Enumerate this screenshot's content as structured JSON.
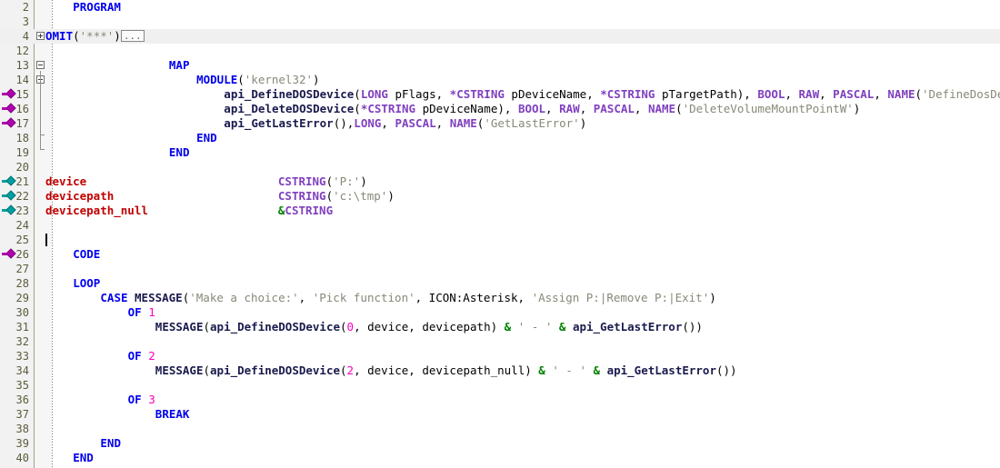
{
  "editor": {
    "language": "Clarion",
    "line_height": 16,
    "first_visible_line": 2,
    "colors": {
      "background": "#ffffff",
      "gutter": "#f2f2f2",
      "line_number": "#5c5c3d",
      "keyword": "#0000ee",
      "type": "#8040c0",
      "function": "#1a1a4d",
      "variable": "#c00000",
      "string": "#888878",
      "number": "#ff00c0",
      "operator": "#008000",
      "highlight_row": "#f0f0f0",
      "marker_bookmark": "#b300b3",
      "marker_breakpoint": "#00a0a0"
    },
    "caret": {
      "line": 25,
      "column": 1
    }
  },
  "lines": [
    {
      "num": "2",
      "indent": 4,
      "highlight": false,
      "marker": "",
      "fold": "",
      "tokens": [
        {
          "t": "PROGRAM",
          "c": "kw"
        }
      ]
    },
    {
      "num": "3",
      "indent": 0,
      "highlight": false,
      "marker": "",
      "fold": "",
      "tokens": []
    },
    {
      "num": "4",
      "indent": 0,
      "highlight": true,
      "marker": "",
      "fold": "plus",
      "tokens": [
        {
          "t": "OMIT",
          "c": "kw"
        },
        {
          "t": "(",
          "c": "pl"
        },
        {
          "t": "'***'",
          "c": "str"
        },
        {
          "t": ")",
          "c": "pl"
        },
        {
          "t": "...",
          "c": "collapsed"
        }
      ]
    },
    {
      "num": "12",
      "indent": 0,
      "highlight": false,
      "marker": "",
      "fold": "",
      "tokens": []
    },
    {
      "num": "13",
      "indent": 18,
      "highlight": false,
      "marker": "",
      "fold": "minus",
      "tokens": [
        {
          "t": "MAP",
          "c": "kw"
        }
      ]
    },
    {
      "num": "14",
      "indent": 22,
      "highlight": false,
      "marker": "",
      "fold": "minus",
      "tokens": [
        {
          "t": "MODULE",
          "c": "kw"
        },
        {
          "t": "(",
          "c": "pl"
        },
        {
          "t": "'kernel32'",
          "c": "str"
        },
        {
          "t": ")",
          "c": "pl"
        }
      ]
    },
    {
      "num": "15",
      "indent": 26,
      "highlight": false,
      "marker": "magenta",
      "fold": "",
      "tokens": [
        {
          "t": "api_DefineDOSDevice",
          "c": "fn"
        },
        {
          "t": "(",
          "c": "pl"
        },
        {
          "t": "LONG",
          "c": "typ"
        },
        {
          "t": " pFlags, ",
          "c": "pl"
        },
        {
          "t": "*CSTRING",
          "c": "typ"
        },
        {
          "t": " pDeviceName, ",
          "c": "pl"
        },
        {
          "t": "*CSTRING",
          "c": "typ"
        },
        {
          "t": " pTargetPath), ",
          "c": "pl"
        },
        {
          "t": "BOOL",
          "c": "typ"
        },
        {
          "t": ", ",
          "c": "pl"
        },
        {
          "t": "RAW",
          "c": "typ"
        },
        {
          "t": ", ",
          "c": "pl"
        },
        {
          "t": "PASCAL",
          "c": "typ"
        },
        {
          "t": ", ",
          "c": "pl"
        },
        {
          "t": "NAME",
          "c": "typ"
        },
        {
          "t": "(",
          "c": "pl"
        },
        {
          "t": "'DefineDosDeviceA'",
          "c": "str"
        },
        {
          "t": ")",
          "c": "pl"
        }
      ]
    },
    {
      "num": "16",
      "indent": 26,
      "highlight": false,
      "marker": "magenta",
      "fold": "",
      "tokens": [
        {
          "t": "api_DeleteDOSDevice",
          "c": "fn"
        },
        {
          "t": "(",
          "c": "pl"
        },
        {
          "t": "*CSTRING",
          "c": "typ"
        },
        {
          "t": " pDeviceName), ",
          "c": "pl"
        },
        {
          "t": "BOOL",
          "c": "typ"
        },
        {
          "t": ", ",
          "c": "pl"
        },
        {
          "t": "RAW",
          "c": "typ"
        },
        {
          "t": ", ",
          "c": "pl"
        },
        {
          "t": "PASCAL",
          "c": "typ"
        },
        {
          "t": ", ",
          "c": "pl"
        },
        {
          "t": "NAME",
          "c": "typ"
        },
        {
          "t": "(",
          "c": "pl"
        },
        {
          "t": "'DeleteVolumeMountPointW'",
          "c": "str"
        },
        {
          "t": ")",
          "c": "pl"
        }
      ]
    },
    {
      "num": "17",
      "indent": 26,
      "highlight": false,
      "marker": "magenta",
      "fold": "",
      "tokens": [
        {
          "t": "api_GetLastError",
          "c": "fn"
        },
        {
          "t": "(),",
          "c": "pl"
        },
        {
          "t": "LONG",
          "c": "typ"
        },
        {
          "t": ", ",
          "c": "pl"
        },
        {
          "t": "PASCAL",
          "c": "typ"
        },
        {
          "t": ", ",
          "c": "pl"
        },
        {
          "t": "NAME",
          "c": "typ"
        },
        {
          "t": "(",
          "c": "pl"
        },
        {
          "t": "'GetLastError'",
          "c": "str"
        },
        {
          "t": ")",
          "c": "pl"
        }
      ]
    },
    {
      "num": "18",
      "indent": 22,
      "highlight": false,
      "marker": "",
      "fold": "",
      "tokens": [
        {
          "t": "END",
          "c": "kw"
        }
      ]
    },
    {
      "num": "19",
      "indent": 18,
      "highlight": false,
      "marker": "",
      "fold": "",
      "tokens": [
        {
          "t": "END",
          "c": "kw"
        }
      ]
    },
    {
      "num": "20",
      "indent": 0,
      "highlight": false,
      "marker": "",
      "fold": "",
      "tokens": []
    },
    {
      "num": "21",
      "indent": 0,
      "highlight": false,
      "marker": "teal",
      "fold": "",
      "tokens": [
        {
          "t": "device",
          "c": "var"
        },
        {
          "t": "                            ",
          "c": "pl"
        },
        {
          "t": "CSTRING",
          "c": "typ"
        },
        {
          "t": "(",
          "c": "pl"
        },
        {
          "t": "'P:'",
          "c": "str"
        },
        {
          "t": ")",
          "c": "pl"
        }
      ]
    },
    {
      "num": "22",
      "indent": 0,
      "highlight": false,
      "marker": "teal",
      "fold": "",
      "tokens": [
        {
          "t": "devicepath",
          "c": "var"
        },
        {
          "t": "                        ",
          "c": "pl"
        },
        {
          "t": "CSTRING",
          "c": "typ"
        },
        {
          "t": "(",
          "c": "pl"
        },
        {
          "t": "'c:\\tmp'",
          "c": "str"
        },
        {
          "t": ")",
          "c": "pl"
        }
      ]
    },
    {
      "num": "23",
      "indent": 0,
      "highlight": false,
      "marker": "teal",
      "fold": "",
      "tokens": [
        {
          "t": "devicepath_null",
          "c": "var"
        },
        {
          "t": "                   ",
          "c": "pl"
        },
        {
          "t": "&",
          "c": "amp"
        },
        {
          "t": "CSTRING",
          "c": "typ"
        }
      ]
    },
    {
      "num": "24",
      "indent": 0,
      "highlight": false,
      "marker": "",
      "fold": "",
      "tokens": []
    },
    {
      "num": "25",
      "indent": 0,
      "highlight": false,
      "marker": "",
      "fold": "",
      "tokens": []
    },
    {
      "num": "26",
      "indent": 4,
      "highlight": false,
      "marker": "magenta",
      "fold": "",
      "tokens": [
        {
          "t": "CODE",
          "c": "kw"
        }
      ]
    },
    {
      "num": "27",
      "indent": 0,
      "highlight": false,
      "marker": "",
      "fold": "",
      "tokens": []
    },
    {
      "num": "28",
      "indent": 4,
      "highlight": false,
      "marker": "",
      "fold": "",
      "tokens": [
        {
          "t": "LOOP",
          "c": "kw"
        }
      ]
    },
    {
      "num": "29",
      "indent": 8,
      "highlight": false,
      "marker": "",
      "fold": "",
      "tokens": [
        {
          "t": "CASE",
          "c": "kw"
        },
        {
          "t": " ",
          "c": "pl"
        },
        {
          "t": "MESSAGE",
          "c": "fn"
        },
        {
          "t": "(",
          "c": "pl"
        },
        {
          "t": "'Make a choice:'",
          "c": "str"
        },
        {
          "t": ", ",
          "c": "pl"
        },
        {
          "t": "'Pick function'",
          "c": "str"
        },
        {
          "t": ", ICON:Asterisk, ",
          "c": "pl"
        },
        {
          "t": "'Assign P:|Remove P:|Exit'",
          "c": "str"
        },
        {
          "t": ")",
          "c": "pl"
        }
      ]
    },
    {
      "num": "30",
      "indent": 12,
      "highlight": false,
      "marker": "",
      "fold": "",
      "tokens": [
        {
          "t": "OF",
          "c": "kw"
        },
        {
          "t": " ",
          "c": "pl"
        },
        {
          "t": "1",
          "c": "num"
        }
      ]
    },
    {
      "num": "31",
      "indent": 16,
      "highlight": false,
      "marker": "",
      "fold": "",
      "tokens": [
        {
          "t": "MESSAGE",
          "c": "fn"
        },
        {
          "t": "(",
          "c": "pl"
        },
        {
          "t": "api_DefineDOSDevice",
          "c": "fn"
        },
        {
          "t": "(",
          "c": "pl"
        },
        {
          "t": "0",
          "c": "num"
        },
        {
          "t": ", device, devicepath) ",
          "c": "pl"
        },
        {
          "t": "&",
          "c": "amp"
        },
        {
          "t": " ",
          "c": "pl"
        },
        {
          "t": "' - '",
          "c": "str"
        },
        {
          "t": " ",
          "c": "pl"
        },
        {
          "t": "&",
          "c": "amp"
        },
        {
          "t": " ",
          "c": "pl"
        },
        {
          "t": "api_GetLastError",
          "c": "fn"
        },
        {
          "t": "())",
          "c": "pl"
        }
      ]
    },
    {
      "num": "32",
      "indent": 0,
      "highlight": false,
      "marker": "",
      "fold": "",
      "tokens": []
    },
    {
      "num": "33",
      "indent": 12,
      "highlight": false,
      "marker": "",
      "fold": "",
      "tokens": [
        {
          "t": "OF",
          "c": "kw"
        },
        {
          "t": " ",
          "c": "pl"
        },
        {
          "t": "2",
          "c": "num"
        }
      ]
    },
    {
      "num": "34",
      "indent": 16,
      "highlight": false,
      "marker": "",
      "fold": "",
      "tokens": [
        {
          "t": "MESSAGE",
          "c": "fn"
        },
        {
          "t": "(",
          "c": "pl"
        },
        {
          "t": "api_DefineDOSDevice",
          "c": "fn"
        },
        {
          "t": "(",
          "c": "pl"
        },
        {
          "t": "2",
          "c": "num"
        },
        {
          "t": ", device, devicepath_null) ",
          "c": "pl"
        },
        {
          "t": "&",
          "c": "amp"
        },
        {
          "t": " ",
          "c": "pl"
        },
        {
          "t": "' - '",
          "c": "str"
        },
        {
          "t": " ",
          "c": "pl"
        },
        {
          "t": "&",
          "c": "amp"
        },
        {
          "t": " ",
          "c": "pl"
        },
        {
          "t": "api_GetLastError",
          "c": "fn"
        },
        {
          "t": "())",
          "c": "pl"
        }
      ]
    },
    {
      "num": "35",
      "indent": 0,
      "highlight": false,
      "marker": "",
      "fold": "",
      "tokens": []
    },
    {
      "num": "36",
      "indent": 12,
      "highlight": false,
      "marker": "",
      "fold": "",
      "tokens": [
        {
          "t": "OF",
          "c": "kw"
        },
        {
          "t": " ",
          "c": "pl"
        },
        {
          "t": "3",
          "c": "num"
        }
      ]
    },
    {
      "num": "37",
      "indent": 16,
      "highlight": false,
      "marker": "",
      "fold": "",
      "tokens": [
        {
          "t": "BREAK",
          "c": "kw"
        }
      ]
    },
    {
      "num": "38",
      "indent": 0,
      "highlight": false,
      "marker": "",
      "fold": "",
      "tokens": []
    },
    {
      "num": "39",
      "indent": 8,
      "highlight": false,
      "marker": "",
      "fold": "",
      "tokens": [
        {
          "t": "END",
          "c": "kw"
        }
      ]
    },
    {
      "num": "40",
      "indent": 4,
      "highlight": false,
      "marker": "",
      "fold": "",
      "tokens": [
        {
          "t": "END",
          "c": "kw"
        }
      ]
    }
  ]
}
